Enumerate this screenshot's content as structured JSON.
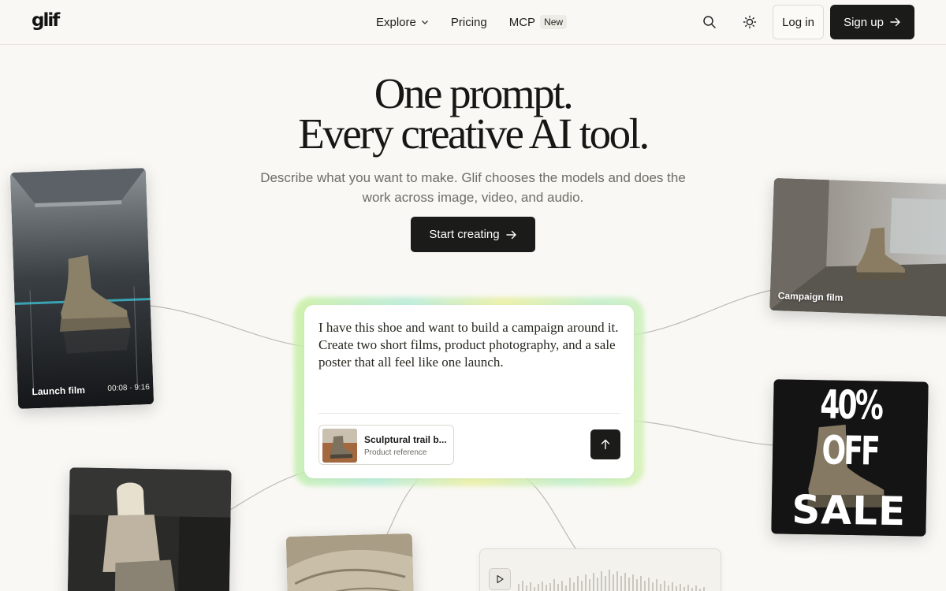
{
  "nav": {
    "logo": "glif",
    "links": [
      {
        "label": "Explore",
        "has_dropdown": true
      },
      {
        "label": "Pricing"
      },
      {
        "label": "MCP",
        "badge": "New"
      }
    ],
    "login": "Log in",
    "signup": "Sign up",
    "icons": [
      "search-icon",
      "sun-icon",
      "arrow-right-icon"
    ]
  },
  "hero": {
    "title_line1": "One prompt.",
    "title_line2": "Every creative AI tool.",
    "subtitle": "Describe what you want to make. Glif chooses the models and does the work across image, video, and audio.",
    "cta": "Start creating"
  },
  "prompt": {
    "text": "I have this shoe and want to build a campaign around it. Create two short films, product photography, and a sale poster that all feel like one launch.",
    "attachment_name": "Sculptural trail b...",
    "attachment_sub": "Product reference"
  },
  "cards": {
    "launch_film": {
      "label": "Launch film",
      "time": "00:08 · 9:16"
    },
    "campaign_film": {
      "label": "Campaign film"
    },
    "sale_poster": {
      "headline": "40% OFF",
      "footer": "SALE"
    }
  },
  "audio": {
    "icon": "play-icon"
  },
  "colors": {
    "background": "#f9f8f4",
    "primary_button": "#1b1c19",
    "glow_green": "#c9f0a0",
    "glow_teal": "#b6ecd8"
  }
}
